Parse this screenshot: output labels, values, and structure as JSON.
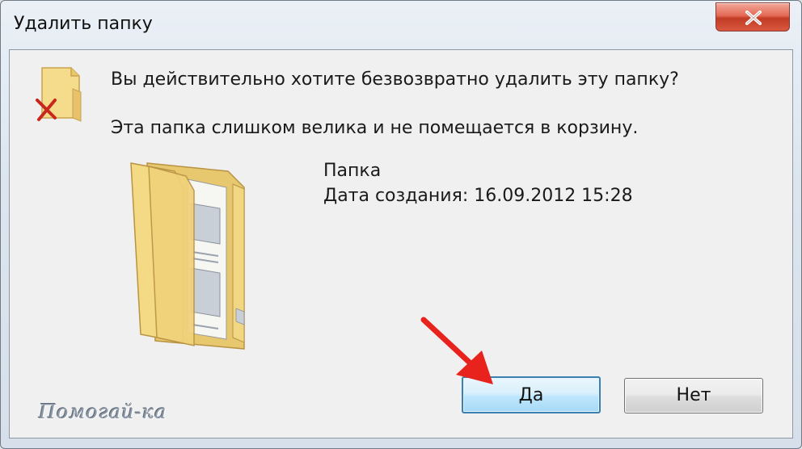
{
  "window": {
    "title": "Удалить папку",
    "close_glyph": "✕"
  },
  "dialog": {
    "question": "Вы действительно хотите безвозвратно удалить эту папку?",
    "info": "Эта папка слишком велика и не помещается в корзину.",
    "item": {
      "name": "Папка",
      "date_created": "Дата создания: 16.09.2012 15:28"
    },
    "icons": {
      "small": "folder-delete-icon",
      "large": "open-folder-icon"
    }
  },
  "buttons": {
    "yes_label": "Да",
    "no_label": "Нет"
  },
  "annotation": {
    "watermark": "Помогай-ка",
    "arrow": "red-arrow-pointing-to-yes",
    "arrow_color": "#e8231d"
  },
  "colors": {
    "title_bg": "#dce5ee",
    "client_bg": "#f0f0f0",
    "close_button": "#d9583f",
    "default_button_border": "#3c7fb1",
    "folder_yellow": "#f2d783"
  }
}
